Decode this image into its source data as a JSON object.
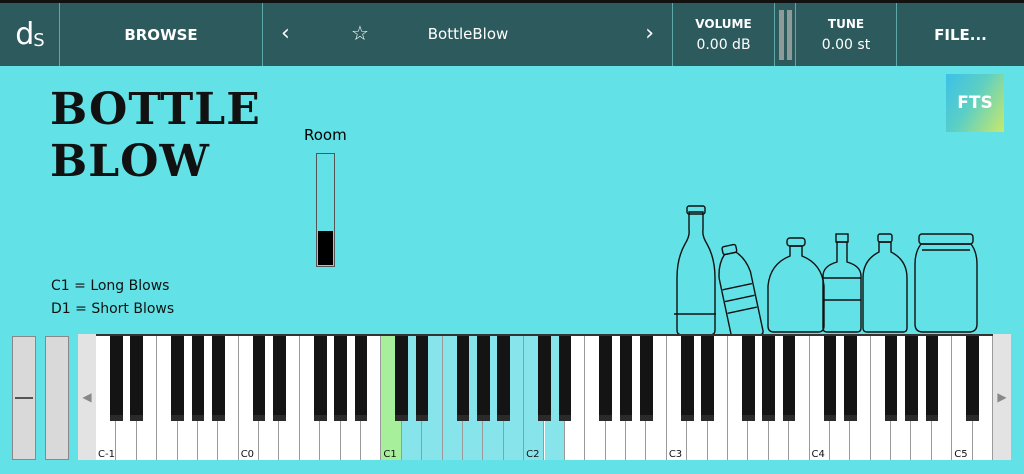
{
  "header": {
    "logo": {
      "main": "d",
      "sub": "S"
    },
    "browse_label": "BROWSE",
    "preset": {
      "prev_icon": "chevron-left-icon",
      "star_icon": "star-outline-icon",
      "name": "BottleBlow",
      "next_icon": "chevron-right-icon"
    },
    "volume": {
      "label": "VOLUME",
      "value": "0.00 dB"
    },
    "tune": {
      "label": "TUNE",
      "value": "0.00 st"
    },
    "file_label": "FILE..."
  },
  "instrument": {
    "title_line1": "BOTTLE",
    "title_line2": "BLOW",
    "room": {
      "label": "Room",
      "level": 0.3
    },
    "legend": [
      "C1 = Long Blows",
      "D1 = Short Blows"
    ],
    "badge": "FTS",
    "illustration_icon": "bottles-illustration-icon"
  },
  "keyboard": {
    "white_keys": 44,
    "octave_labels": [
      "C-1",
      "C0",
      "C1",
      "C2",
      "C3",
      "C4",
      "C5"
    ],
    "pressed_white_indices": [
      14
    ],
    "highlighted_range": [
      14,
      22
    ],
    "colors": {
      "pressed": "#a7ef9a",
      "highlight": "#86e4ea",
      "panel": "#62e1e6",
      "header": "#2d5a5c"
    }
  }
}
